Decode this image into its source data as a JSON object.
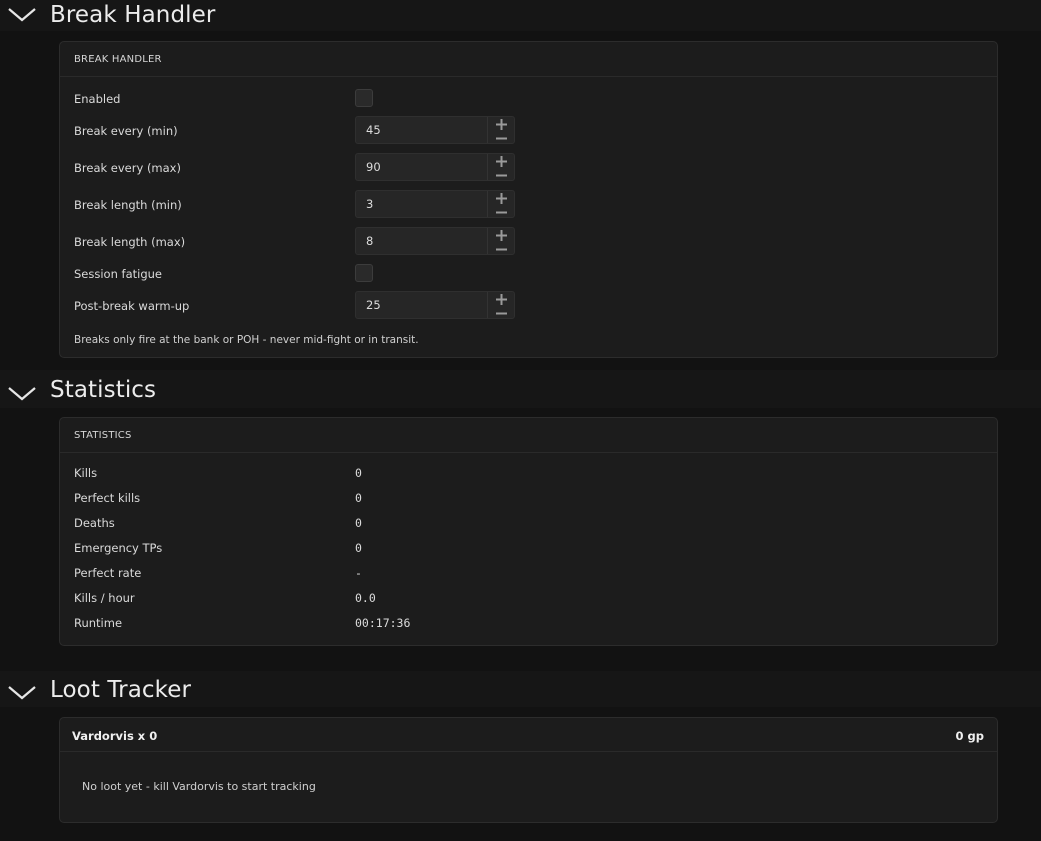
{
  "break_handler": {
    "section_title": "Break Handler",
    "panel_title": "BREAK HANDLER",
    "enabled_label": "Enabled",
    "enabled_checked": false,
    "break_every_min": {
      "label": "Break every (min)",
      "value": "45"
    },
    "break_every_max": {
      "label": "Break every (max)",
      "value": "90"
    },
    "break_length_min": {
      "label": "Break length (min)",
      "value": "3"
    },
    "break_length_max": {
      "label": "Break length (max)",
      "value": "8"
    },
    "session_fatigue_label": "Session fatigue",
    "session_fatigue_checked": false,
    "post_break_warmup": {
      "label": "Post-break warm-up",
      "value": "25"
    },
    "note": "Breaks only fire at the bank or POH - never mid-fight or in transit."
  },
  "statistics": {
    "section_title": "Statistics",
    "panel_title": "STATISTICS",
    "rows": [
      {
        "label": "Kills",
        "value": "0"
      },
      {
        "label": "Perfect kills",
        "value": "0"
      },
      {
        "label": "Deaths",
        "value": "0"
      },
      {
        "label": "Emergency TPs",
        "value": "0"
      },
      {
        "label": "Perfect rate",
        "value": "-"
      },
      {
        "label": "Kills / hour",
        "value": "0.0"
      },
      {
        "label": "Runtime",
        "value": "00:17:36"
      }
    ]
  },
  "loot_tracker": {
    "section_title": "Loot Tracker",
    "boss_title": "Vardorvis  x 0",
    "total": "0 gp",
    "empty_message": "No loot yet - kill Vardorvis to start tracking"
  },
  "icons": {
    "collapse": "chevron-down-icon",
    "increment": "plus-icon",
    "decrement": "minus-icon"
  },
  "colors": {
    "background": "#121212",
    "panel": "#1c1c1c",
    "header": "#161616"
  }
}
